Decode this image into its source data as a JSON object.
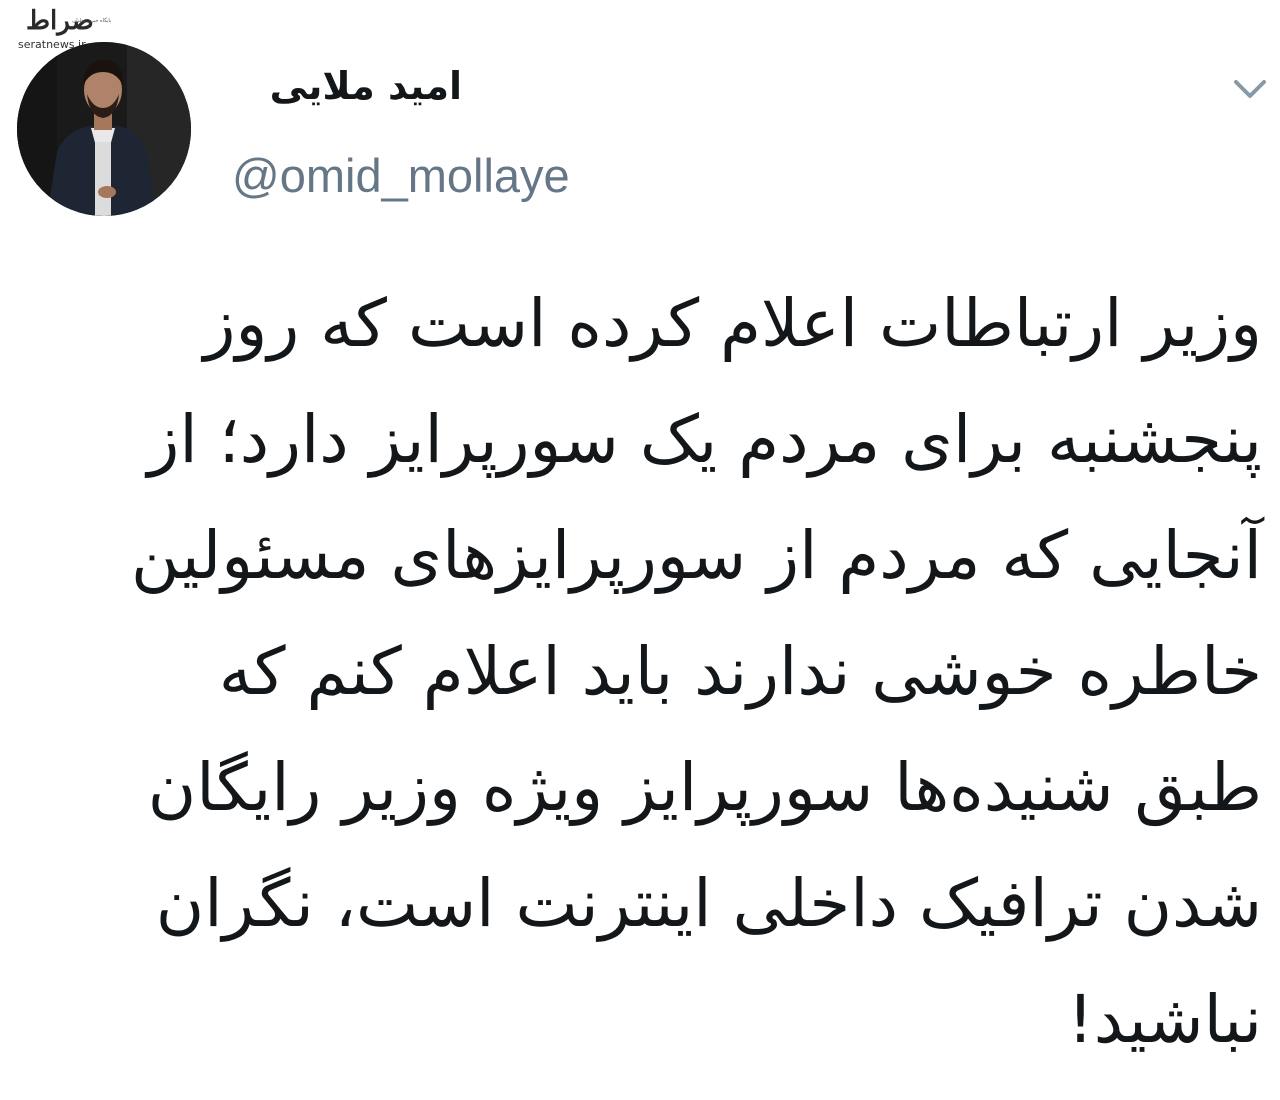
{
  "watermark": {
    "logo": "صراط",
    "tagline": "پایگاه خبری تحلیلی",
    "site": "seratnews.ir"
  },
  "tweet": {
    "author": {
      "display_name": "امید ملایی",
      "handle": "@omid_mollaye",
      "avatar_icon": "avatar-photo"
    },
    "menu_icon": "chevron-down-icon",
    "text_lines": [
      "وزیر ارتباطات اعلام کرده است که روز",
      "پنجشنبه برای مردم یک سورپرایز دارد؛ از",
      "آنجایی که مردم از سورپرایزهای مسئولین",
      "خاطره خوشی ندارند باید اعلام کنم که",
      "طبق شنیده‌ها سورپرایز ویژه وزیر رایگان",
      "شدن ترافیک داخلی اینترنت است، نگران",
      "نباشید!"
    ]
  },
  "colors": {
    "text": "#14171a",
    "handle": "#657786",
    "chevron": "#8899a6",
    "background": "#ffffff"
  }
}
